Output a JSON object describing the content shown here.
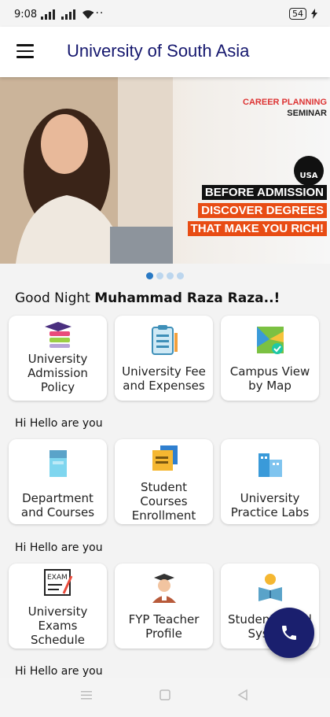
{
  "status_bar": {
    "time": "9:08",
    "more": "···",
    "battery": "54"
  },
  "app_bar": {
    "title": "University of South Asia"
  },
  "banner": {
    "line1": "CAREER PLANNING",
    "line2": "SEMINAR",
    "logo": "USA",
    "tag1": "BEFORE ADMISSION",
    "tag2": "DISCOVER DEGREES",
    "tag3": "THAT MAKE YOU RICH!",
    "pages": 4,
    "active_page": 1
  },
  "greeting": {
    "prefix": "Good Night",
    "name": "Muhammad Raza Raza..!"
  },
  "rows": [
    {
      "cards": [
        {
          "label": "University Admission Policy",
          "icon": "graduation-cap-icon"
        },
        {
          "label": "University Fee and Expenses",
          "icon": "clipboard-icon"
        },
        {
          "label": "Campus View by Map",
          "icon": "map-icon"
        }
      ]
    },
    {
      "section": "Hi Hello are you",
      "cards": [
        {
          "label": "Department and Courses",
          "icon": "building-icon"
        },
        {
          "label": "Student Courses Enrollment",
          "icon": "folder-icon"
        },
        {
          "label": "University Practice Labs",
          "icon": "city-icon"
        }
      ]
    },
    {
      "section": "Hi Hello are you",
      "cards": [
        {
          "label": "University Exams Schedule",
          "icon": "exam-icon"
        },
        {
          "label": "FYP Teacher Profile",
          "icon": "teacher-icon"
        },
        {
          "label": "Student Portal System",
          "icon": "reading-icon"
        }
      ]
    },
    {
      "section": "Hi Hello are you"
    }
  ],
  "fab": {
    "icon": "phone-icon"
  },
  "nav": {
    "menu": "menu-nav-icon",
    "home": "home-nav-icon",
    "back": "back-nav-icon"
  },
  "colors": {
    "primary": "#15176e",
    "fab": "#1a1f6e",
    "tag_orange": "#e84c14"
  }
}
